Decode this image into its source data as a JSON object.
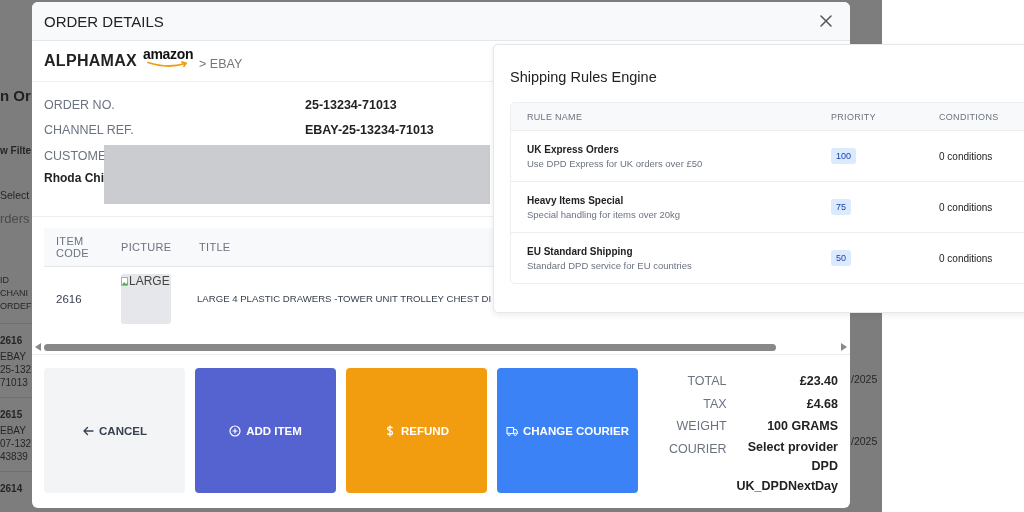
{
  "background_page": {
    "title_fragment": "n Or",
    "filter_fragment": "w Filte",
    "select_fragment": "Select",
    "search_fragment": "rders",
    "column_header_fragments": [
      "ID",
      "CHANI",
      "ORDEF"
    ],
    "rows": [
      {
        "lines": [
          "2616",
          "EBAY",
          "25-132",
          "71013"
        ]
      },
      {
        "lines": [
          "2615",
          "EBAY",
          "07-132",
          "43839"
        ]
      },
      {
        "lines": [
          "2614"
        ]
      }
    ],
    "dates": [
      "/2025",
      "/2025"
    ]
  },
  "order_details": {
    "title": "ORDER DETAILS",
    "brand": {
      "name": "ALPHAMAX",
      "logo_text": "amazon",
      "channel": "> EBAY"
    },
    "fields": [
      {
        "label": "ORDER NO.",
        "value": "25-13234-71013"
      },
      {
        "label": "CHANNEL REF.",
        "value": "EBAY-25-13234-71013"
      },
      {
        "label": "CUSTOME"
      }
    ],
    "customer_address": "Rhoda Chi",
    "items": {
      "columns": [
        "ITEM CODE",
        "PICTURE",
        "TITLE"
      ],
      "rows": [
        {
          "item_code": "2616",
          "picture_alt": "LARGE",
          "title": "LARGE 4 PLASTIC DRAWERS -TOWER UNIT TROLLEY CHEST DI"
        }
      ]
    },
    "buttons": [
      {
        "kind": "cancel",
        "label": "CANCEL"
      },
      {
        "kind": "add",
        "label": "ADD ITEM"
      },
      {
        "kind": "refund",
        "label": "REFUND"
      },
      {
        "kind": "courier",
        "label": "CHANGE COURIER"
      }
    ],
    "summary": [
      {
        "label": "TOTAL",
        "values": [
          "£23.40"
        ]
      },
      {
        "label": "TAX",
        "values": [
          "£4.68"
        ]
      },
      {
        "label": "WEIGHT",
        "values": [
          "100 GRAMS"
        ]
      },
      {
        "label": "COURIER",
        "values": [
          "Select provider",
          "DPD",
          "UK_DPDNextDay"
        ]
      }
    ]
  },
  "shipping_rules": {
    "title": "Shipping Rules Engine",
    "columns": [
      "RULE NAME",
      "PRIORITY",
      "CONDITIONS"
    ],
    "rules": [
      {
        "name": "UK Express Orders",
        "description": "Use DPD Express for UK orders over £50",
        "priority": "100",
        "conditions": "0 conditions"
      },
      {
        "name": "Heavy Items Special",
        "description": "Special handling for items over 20kg",
        "priority": "75",
        "conditions": "0 conditions"
      },
      {
        "name": "EU Standard Shipping",
        "description": "Standard DPD service for EU countries",
        "priority": "50",
        "conditions": "0 conditions"
      }
    ]
  }
}
